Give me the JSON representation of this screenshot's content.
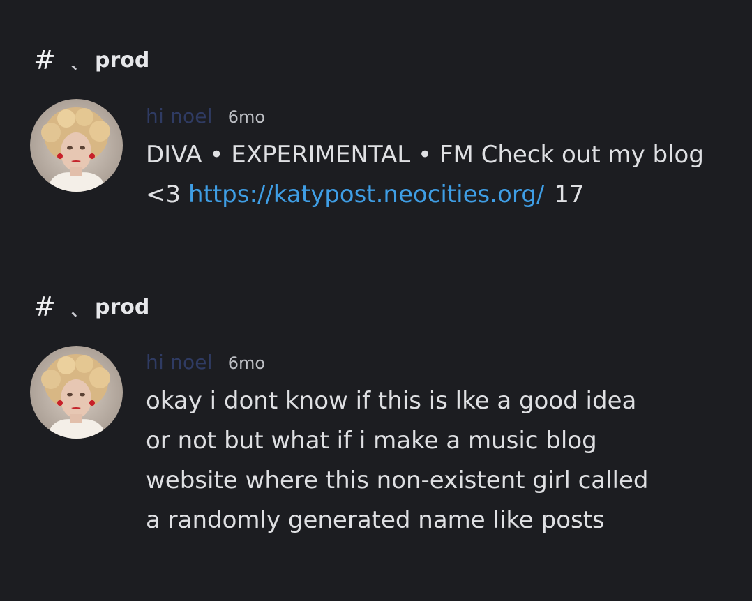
{
  "posts": [
    {
      "channel": {
        "hash": "#",
        "separator": "、",
        "name": "prod"
      },
      "author": "hi noel",
      "time": "6mo",
      "text_before_link": "DIVA • EXPERIMENTAL • FM Check out my blog <3 ",
      "link": "https://katypost.neocities.org/",
      "count": "17"
    },
    {
      "channel": {
        "hash": "#",
        "separator": "、",
        "name": "prod"
      },
      "author": "hi noel",
      "time": "6mo",
      "lines": [
        "okay i dont know if this is lke a good idea",
        "or not but what if i make a music blog",
        "website where this non-existent girl called",
        "a randomly generated name like posts"
      ]
    }
  ],
  "colors": {
    "background": "#1c1d21",
    "text": "#dfe0e3",
    "author": "#2f3b63",
    "link": "#3f9ee5",
    "muted": "#bfc1c6"
  }
}
